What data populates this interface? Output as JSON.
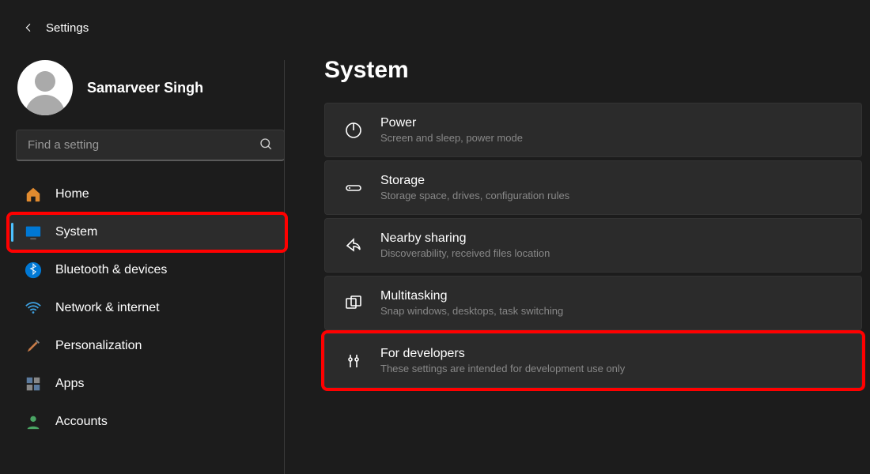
{
  "header": {
    "title": "Settings"
  },
  "user": {
    "name": "Samarveer Singh"
  },
  "search": {
    "placeholder": "Find a setting"
  },
  "sidebar": {
    "items": [
      {
        "label": "Home"
      },
      {
        "label": "System"
      },
      {
        "label": "Bluetooth & devices"
      },
      {
        "label": "Network & internet"
      },
      {
        "label": "Personalization"
      },
      {
        "label": "Apps"
      },
      {
        "label": "Accounts"
      }
    ]
  },
  "main": {
    "heading": "System",
    "panels": [
      {
        "title": "Power",
        "sub": "Screen and sleep, power mode"
      },
      {
        "title": "Storage",
        "sub": "Storage space, drives, configuration rules"
      },
      {
        "title": "Nearby sharing",
        "sub": "Discoverability, received files location"
      },
      {
        "title": "Multitasking",
        "sub": "Snap windows, desktops, task switching"
      },
      {
        "title": "For developers",
        "sub": "These settings are intended for development use only"
      }
    ]
  }
}
